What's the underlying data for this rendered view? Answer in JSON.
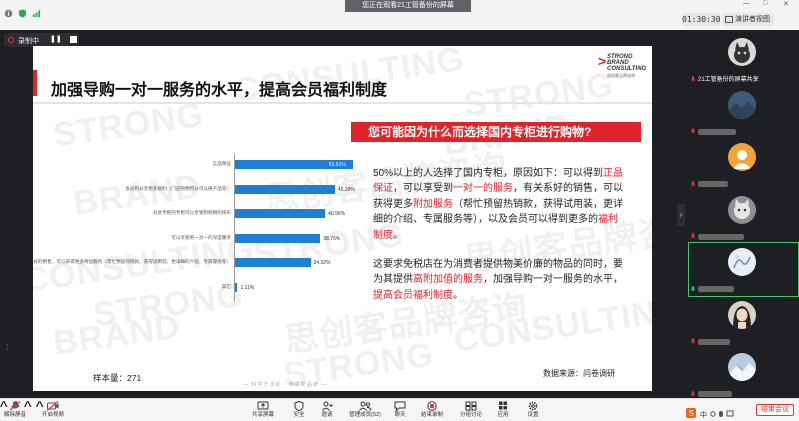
{
  "top_bar": {
    "share_banner": "您正在观看21工管备份的屏幕",
    "timer": "01:30:30",
    "speaker_view_label": "演讲者视图",
    "window_controls": [
      "—",
      "□",
      "✕"
    ]
  },
  "recording": {
    "label": "录制中"
  },
  "slide": {
    "title": "加强导购一对一服务的水平，提高会员福利制度",
    "logo_lines": [
      "STRONG",
      "BRAND",
      "CONSULTING",
      "思创客品牌咨询"
    ],
    "question": "您可能因为什么而选择国内专柜进行购物?",
    "watermark_en": [
      "STRONG",
      "BRAND",
      "CONSULTING"
    ],
    "watermark_cn": "思创客品牌咨询",
    "para1": [
      {
        "t": "50%以上的人选择了国内专柜，原因如下：可以得到",
        "h": false
      },
      {
        "t": "正品保证",
        "h": true
      },
      {
        "t": "，可以享受到",
        "h": false
      },
      {
        "t": "一对一的服务",
        "h": true
      },
      {
        "t": "，有关系好的销售，可以获得更多",
        "h": false
      },
      {
        "t": "附加服务",
        "h": true
      },
      {
        "t": "（帮忙预留热销款，获得试用装，更详细的介绍、专属服务等），以及会员可以得到更多的",
        "h": false
      },
      {
        "t": "福利制度",
        "h": true
      },
      {
        "t": "。",
        "h": false
      }
    ],
    "para2": [
      {
        "t": "这要求免税店在为消费者提供物美价廉的物品的同时，要为其提供",
        "h": false
      },
      {
        "t": "高附加值的服务",
        "h": true
      },
      {
        "t": "，加强导购一对一服务的水平，",
        "h": false
      },
      {
        "t": "提高会员福利制度",
        "h": true
      },
      {
        "t": "。",
        "h": false
      }
    ],
    "sample_size": "样本量：271",
    "data_source": "数据来源：问卷调研",
    "footer_slogan": "— 科学方法论 · 精耕新品牌 —"
  },
  "chart_data": {
    "type": "bar",
    "orientation": "horizontal",
    "categories": [
      "正品保证",
      "会员积分享更多福利（门店购物积分可以换产品等）",
      "对此专柜的专柜可以享受到购物的快乐",
      "可以享受到一对一的深度服务",
      "有关系好的销售，可以获得更多附加服务（帮忙预留热销款、获得试用装、更详细的介绍、专属服务等）",
      "其它"
    ],
    "values": [
      53.51,
      45.39,
      40.96,
      38.75,
      34.32,
      1.11
    ],
    "value_labels": [
      "53.51%",
      "45.39%",
      "40.96%",
      "38.75%",
      "34.32%",
      "1.11%"
    ],
    "unit": "%",
    "xlim": [
      0,
      100
    ],
    "bar_color": "#1f7fd3"
  },
  "participants": [
    {
      "name": "21工管备份的屏幕共享",
      "avatar": "cat",
      "mic_on": false
    },
    {
      "name": "",
      "avatar": "mountain",
      "mic_on": false
    },
    {
      "name": "",
      "avatar": "orange",
      "mic_on": false
    },
    {
      "name": "",
      "avatar": "kitten",
      "mic_on": false
    },
    {
      "name": "",
      "avatar": "drawing",
      "mic_on": true,
      "active": true
    },
    {
      "name": "",
      "avatar": "girl",
      "mic_on": false
    },
    {
      "name": "",
      "avatar": "snow",
      "mic_on": false
    }
  ],
  "toolbar": {
    "unmute": "解除静音",
    "start_video": "开启视频",
    "share_screen": "共享屏幕",
    "security": "安全",
    "invite": "邀请",
    "manage_members": "管理成员(52)",
    "chat": "聊天",
    "end_recording": "结束录制",
    "breakout": "分组讨论",
    "apps": "应用",
    "settings": "设置",
    "end_meeting": "结束会议"
  },
  "colors": {
    "accent_red": "#e0242c",
    "bar_blue": "#1f7fd3",
    "app_dark": "#1e1f22",
    "active_green": "#47c26b"
  }
}
